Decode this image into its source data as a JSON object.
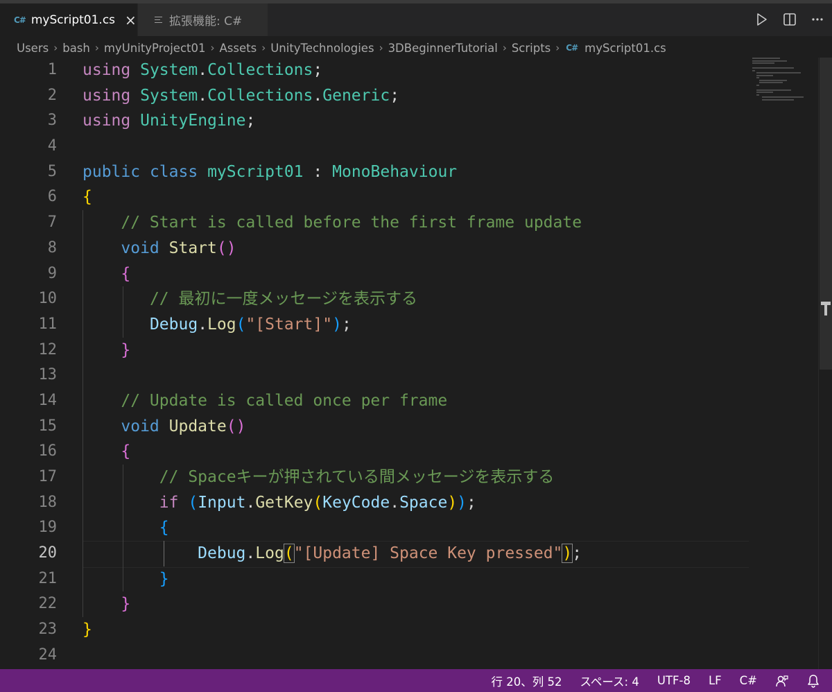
{
  "tabs": [
    {
      "icon": "C#",
      "label": "myScript01.cs",
      "close": "×"
    },
    {
      "label": "拡張機能: C#"
    }
  ],
  "breadcrumb": {
    "items": [
      "Users",
      "bash",
      "myUnityProject01",
      "Assets",
      "UnityTechnologies",
      "3DBeginnerTutorial",
      "Scripts"
    ],
    "file_icon": "C#",
    "file": "myScript01.cs",
    "separator": "›"
  },
  "editor": {
    "current_line": 20,
    "line_numbers": [
      "1",
      "2",
      "3",
      "4",
      "5",
      "6",
      "7",
      "8",
      "9",
      "10",
      "11",
      "12",
      "13",
      "14",
      "15",
      "16",
      "17",
      "18",
      "19",
      "20",
      "21",
      "22",
      "23",
      "24"
    ],
    "code": {
      "kw_using": "using",
      "system": "System",
      "collections": "Collections",
      "generic": "Generic",
      "unityengine": "UnityEngine",
      "kw_public": "public",
      "kw_class": "class",
      "class_name": "myScript01",
      "base_class": "MonoBehaviour",
      "comment_start": "// Start is called before the first frame update",
      "kw_void": "void",
      "fn_start": "Start",
      "comment_first": "// 最初に一度メッセージを表示する",
      "debug": "Debug",
      "log": "Log",
      "str_start": "\"[Start]\"",
      "comment_update": "// Update is called once per frame",
      "fn_update": "Update",
      "comment_space": "// Spaceキーが押されている間メッセージを表示する",
      "kw_if": "if",
      "input": "Input",
      "getkey": "GetKey",
      "keycode": "KeyCode",
      "space": "Space",
      "str_update": "\"[Update] Space Key pressed\""
    }
  },
  "statusbar": {
    "position": "行 20、列 52",
    "indent": "スペース: 4",
    "encoding": "UTF-8",
    "eol": "LF",
    "language": "C#"
  },
  "icons": {
    "run": "run-icon",
    "split": "split-editor-icon",
    "more": "more-actions-icon",
    "feedback": "feedback-icon",
    "bell": "bell-icon"
  },
  "colors": {
    "statusbar_bg": "#68217a",
    "editor_bg": "#1e1e1e",
    "comment": "#6a9955",
    "keyword": "#569cd6",
    "control": "#c586c0",
    "type": "#4ec9b0",
    "string": "#ce9178"
  }
}
